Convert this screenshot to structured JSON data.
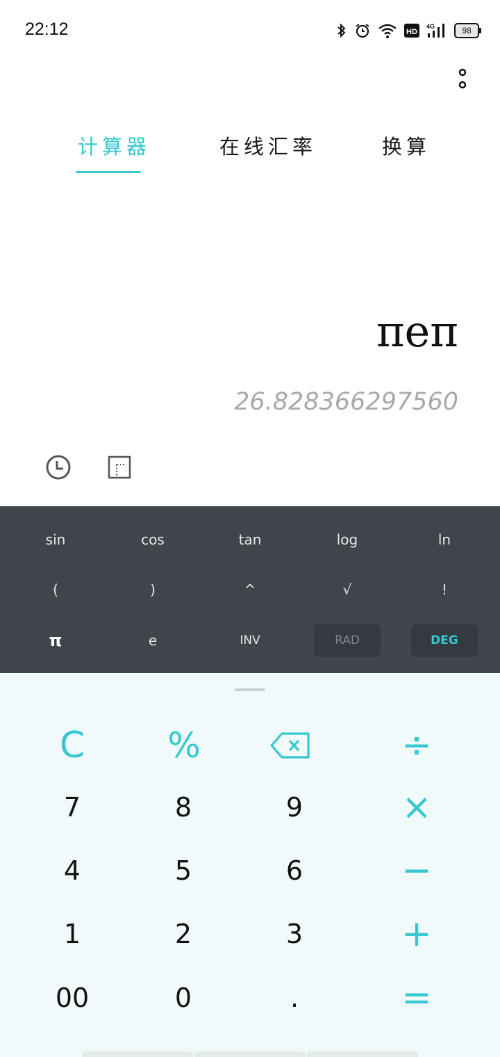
{
  "status_bar": {
    "time": "22:12",
    "battery": "98",
    "icons": [
      "bluetooth-icon",
      "alarm-icon",
      "wifi-icon",
      "hd-icon",
      "signal-4g-icon",
      "battery-icon"
    ]
  },
  "menu": {
    "icon": "more-vertical-icon"
  },
  "tabs": [
    {
      "label": "计算器",
      "active": true
    },
    {
      "label": "在线汇率",
      "active": false
    },
    {
      "label": "换算",
      "active": false
    }
  ],
  "display": {
    "expression": "πeπ",
    "result": "26.828366297560"
  },
  "tools": [
    {
      "icon": "history-clock-icon"
    },
    {
      "icon": "dotted-square-icon"
    }
  ],
  "scientific": {
    "row1": [
      "sin",
      "cos",
      "tan",
      "log",
      "ln"
    ],
    "row2": [
      "(",
      ")",
      "^",
      "√",
      "!"
    ],
    "row3": [
      "π",
      "e",
      "INV",
      "RAD",
      "DEG"
    ],
    "active_mode": "DEG"
  },
  "keypad": {
    "row1": [
      "C",
      "%",
      "backspace",
      "÷"
    ],
    "row2": [
      "7",
      "8",
      "9",
      "×"
    ],
    "row3": [
      "4",
      "5",
      "6",
      "−"
    ],
    "row4": [
      "1",
      "2",
      "3",
      "+"
    ],
    "row5": [
      "00",
      "0",
      ".",
      "="
    ]
  },
  "colors": {
    "accent": "#36c8d0",
    "sci_panel": "#40454c",
    "keypad_bg": "#f1fafb",
    "result_text": "#a9a9a9"
  }
}
